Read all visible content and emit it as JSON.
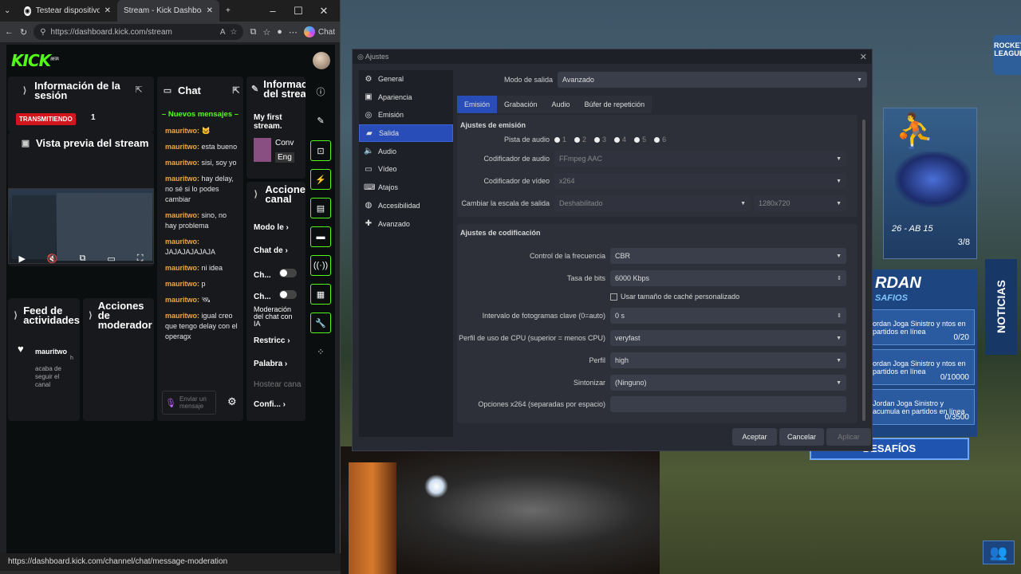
{
  "browser": {
    "tabs": [
      {
        "label": "Testear dispositivos WiFi"
      },
      {
        "label": "Stream - Kick Dashboard"
      }
    ],
    "url": "https://dashboard.kick.com/stream",
    "chat_button": "Chat",
    "status_url": "https://dashboard.kick.com/channel/chat/message-moderation"
  },
  "kick": {
    "logo": "KICK",
    "logo_badge": "BETA",
    "session": {
      "title": "Información de la sesión",
      "live_badge": "TRANSMITIENDO",
      "viewers": "1"
    },
    "preview": {
      "title": "Vista previa del stream"
    },
    "feed": {
      "title": "Feed de actividades",
      "user": "mauritwo",
      "text": "acaba de seguir el canal",
      "time": "h"
    },
    "mod_actions": {
      "title": "Acciones de moderador"
    },
    "chat": {
      "title": "Chat",
      "new_messages": "Nuevos mensajes",
      "messages": [
        {
          "user": "mauritwo:",
          "text": ""
        },
        {
          "user": "mauritwo:",
          "text": "esta bueno"
        },
        {
          "user": "mauritwo:",
          "text": "sisi, soy yo"
        },
        {
          "user": "mauritwo:",
          "text": "hay delay, no sé si lo podes cambiar"
        },
        {
          "user": "mauritwo:",
          "text": "sino, no hay problema"
        },
        {
          "user": "mauritwo:",
          "text": "JAJAJAJAJAJA"
        },
        {
          "user": "mauritwo:",
          "text": "ni idea"
        },
        {
          "user": "mauritwo:",
          "text": "p"
        },
        {
          "user": "mauritwo:",
          "text": ""
        },
        {
          "user": "mauritwo:",
          "text": "igual creo que tengo delay con el operagx"
        }
      ],
      "input_placeholder": "Enviar un mensaje"
    },
    "stream_info": {
      "title": "Información del stream",
      "stream_title": "My first stream.",
      "category": "Conv",
      "lang": "Eng"
    },
    "actions": {
      "title": "Acciones de canal",
      "items": [
        "Modo le",
        "Chat de",
        "Ch...",
        "Ch...",
        "Moderación del chat con IA",
        "Restricc",
        "Palabra",
        "Hostear cana",
        "Confi..."
      ]
    }
  },
  "obs": {
    "title": "Ajustes",
    "nav": [
      {
        "label": "General",
        "icon": "gear-icon"
      },
      {
        "label": "Apariencia",
        "icon": "palette-icon"
      },
      {
        "label": "Emisión",
        "icon": "globe-icon"
      },
      {
        "label": "Salida",
        "icon": "output-icon"
      },
      {
        "label": "Audio",
        "icon": "speaker-icon"
      },
      {
        "label": "Vídeo",
        "icon": "monitor-icon"
      },
      {
        "label": "Atajos",
        "icon": "keyboard-icon"
      },
      {
        "label": "Accesibilidad",
        "icon": "accessibility-icon"
      },
      {
        "label": "Avanzado",
        "icon": "tools-icon"
      }
    ],
    "output_mode_label": "Modo de salida",
    "output_mode_value": "Avanzado",
    "tabs": [
      "Emisión",
      "Grabación",
      "Audio",
      "Búfer de repetición"
    ],
    "emission_section": "Ajustes de emisión",
    "audio_track_label": "Pista de audio",
    "audio_tracks": [
      "1",
      "2",
      "3",
      "4",
      "5",
      "6"
    ],
    "audio_encoder_label": "Codificador de audio",
    "audio_encoder_value": "FFmpeg AAC",
    "video_encoder_label": "Codificador de vídeo",
    "video_encoder_value": "x264",
    "rescale_label": "Cambiar la escala de salida",
    "rescale_value": "Deshabilitado",
    "rescale_res": "1280x720",
    "encode_section": "Ajustes de codificación",
    "rate_control_label": "Control de la frecuencia",
    "rate_control_value": "CBR",
    "bitrate_label": "Tasa de bits",
    "bitrate_value": "6000 Kbps",
    "custom_buffer_label": "Usar tamaño de caché personalizado",
    "keyframe_label": "Intervalo de fotogramas clave (0=auto)",
    "keyframe_value": "0 s",
    "cpu_preset_label": "Perfil de uso de CPU (superior = menos CPU)",
    "cpu_preset_value": "veryfast",
    "profile_label": "Perfil",
    "profile_value": "high",
    "tune_label": "Sintonizar",
    "tune_value": "(Ninguno)",
    "x264_opts_label": "Opciones x264 (separadas por espacio)",
    "buttons": {
      "accept": "Aceptar",
      "cancel": "Cancelar",
      "apply": "Aplicar"
    }
  },
  "game": {
    "item_code": "26 - AB 15",
    "item_count": "3/8",
    "challenge_title": "RDAN",
    "challenge_sub": "SAFIOS",
    "challenges": [
      {
        "text": "ordan Joga Sinistro y ntos en partidos en línea",
        "progress": "0/20"
      },
      {
        "text": "ordan Joga Sinistro y ntos en partidos en línea",
        "progress": "0/10000"
      },
      {
        "text": "Jordan Joga Sinistro y acumula en partidos en línea",
        "progress": "0/3500"
      }
    ],
    "challenge_button": "DESAFÍOS",
    "news": "NOTICIAS",
    "logo": "ROCKET LEAGUE"
  }
}
